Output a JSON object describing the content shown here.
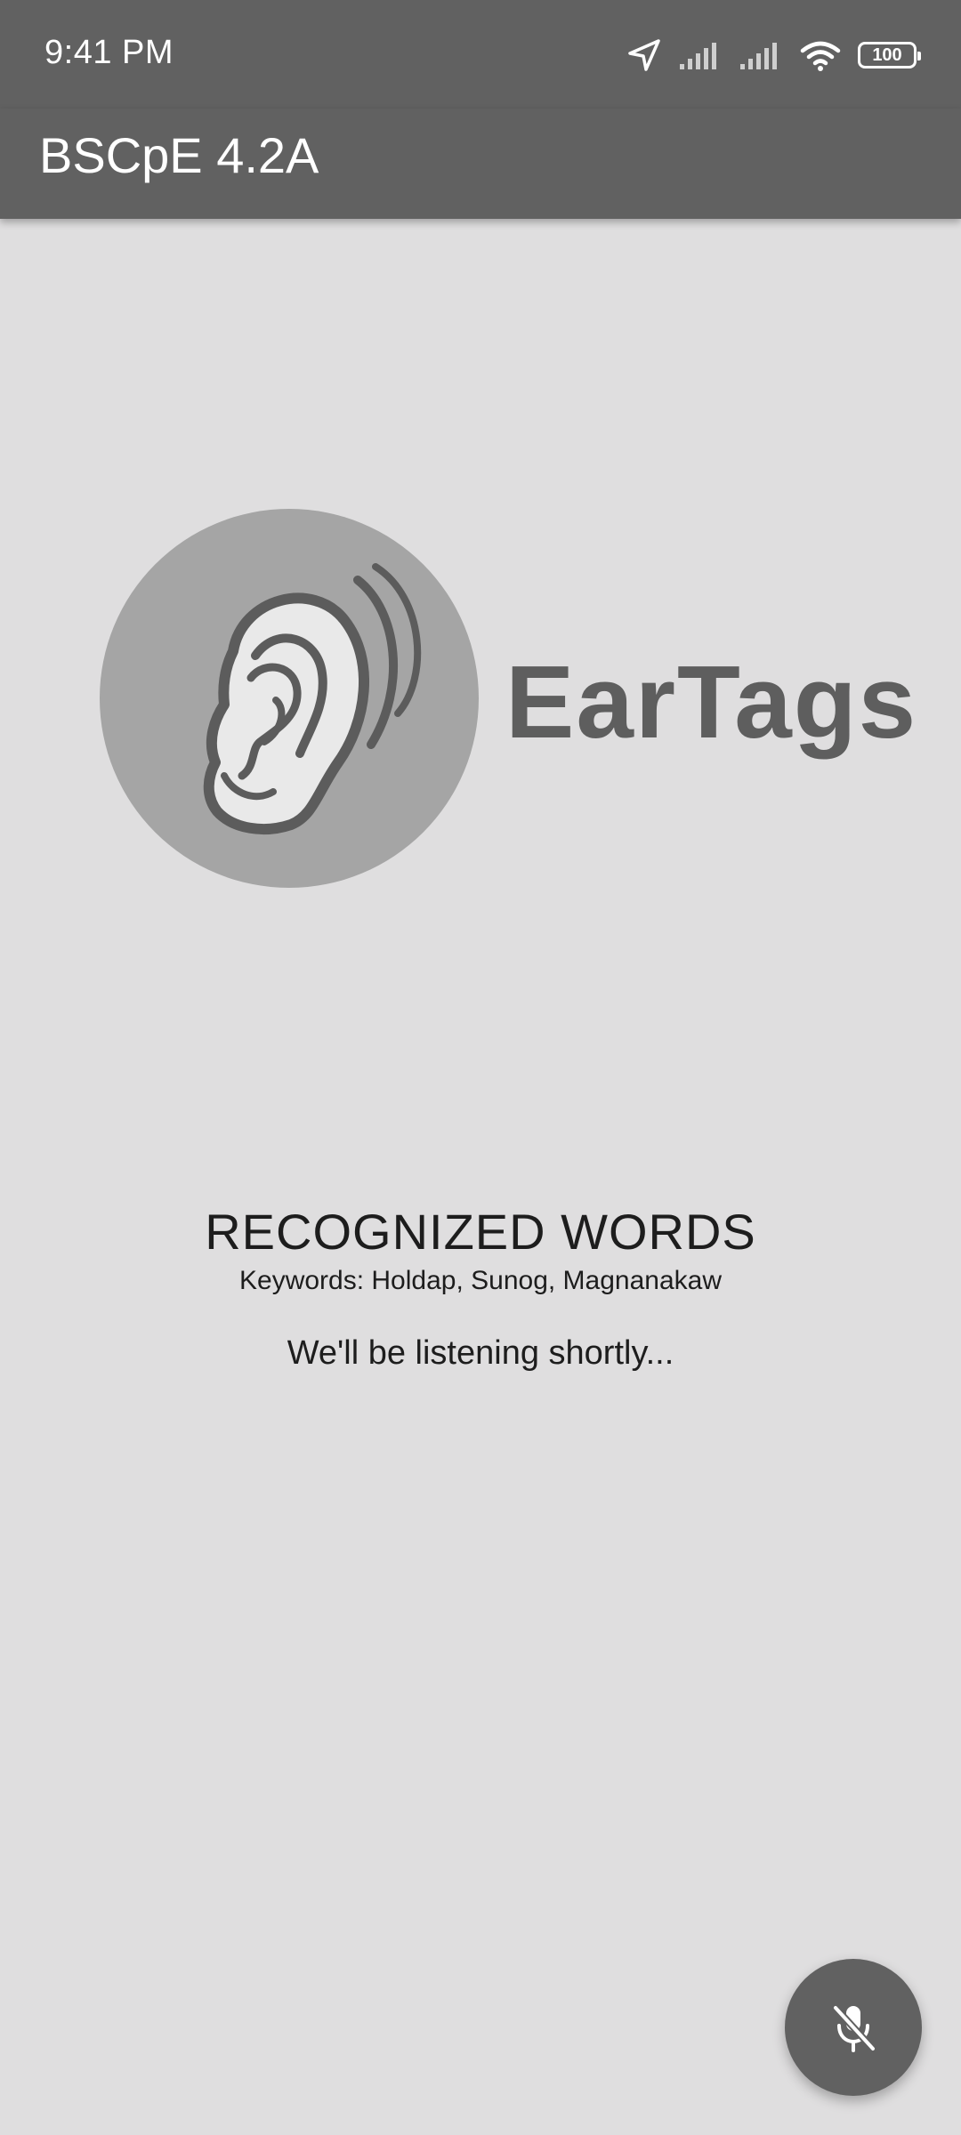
{
  "status_bar": {
    "time": "9:41 PM",
    "battery": "100",
    "icons": [
      "location-arrow-icon",
      "signal-icon",
      "signal-icon",
      "wifi-icon",
      "battery-icon"
    ]
  },
  "app_bar": {
    "title": "BSCpE 4.2A"
  },
  "logo": {
    "text": "EarTags",
    "icon": "ear-icon"
  },
  "recognized": {
    "title": "RECOGNIZED WORDS",
    "keywords": "Keywords: Holdap, Sunog, Magnanakaw",
    "status": "We'll be listening shortly..."
  },
  "fab": {
    "icon": "mic-off-icon"
  },
  "colors": {
    "bar": "#616161",
    "background": "#dfdedf",
    "logo_circle": "#a5a5a5",
    "logo_text": "#5e5e5e",
    "text": "#1d1d1d"
  }
}
